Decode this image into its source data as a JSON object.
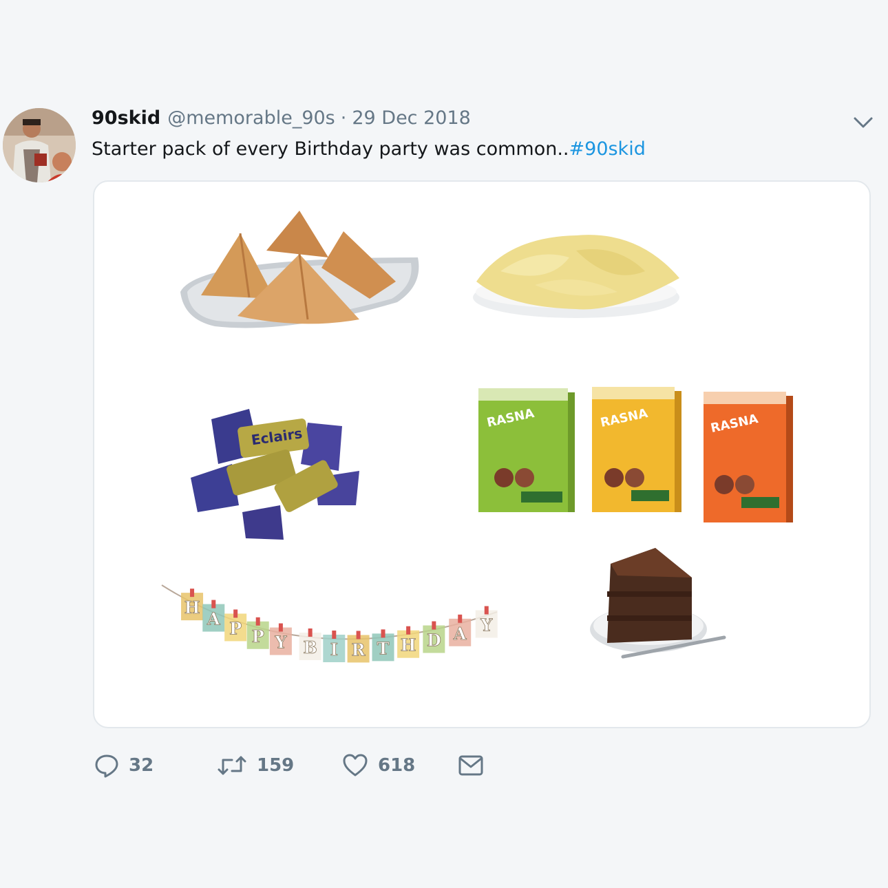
{
  "tweet": {
    "display_name": "90skid",
    "handle": "@memorable_90s",
    "separator": "·",
    "date": "29 Dec 2018",
    "text": "Starter pack of every Birthday party was common..",
    "hashtag": "#90skid"
  },
  "media": {
    "eclair_label": "Eclairs",
    "rasna_label": "RASNA",
    "banner_letters": [
      "H",
      "A",
      "P",
      "P",
      "Y",
      "B",
      "I",
      "R",
      "T",
      "H",
      "D",
      "A",
      "Y"
    ]
  },
  "actions": {
    "reply_count": "32",
    "retweet_count": "159",
    "like_count": "618"
  },
  "colors": {
    "hashtag": "#1b95e0",
    "muted": "#657786"
  }
}
